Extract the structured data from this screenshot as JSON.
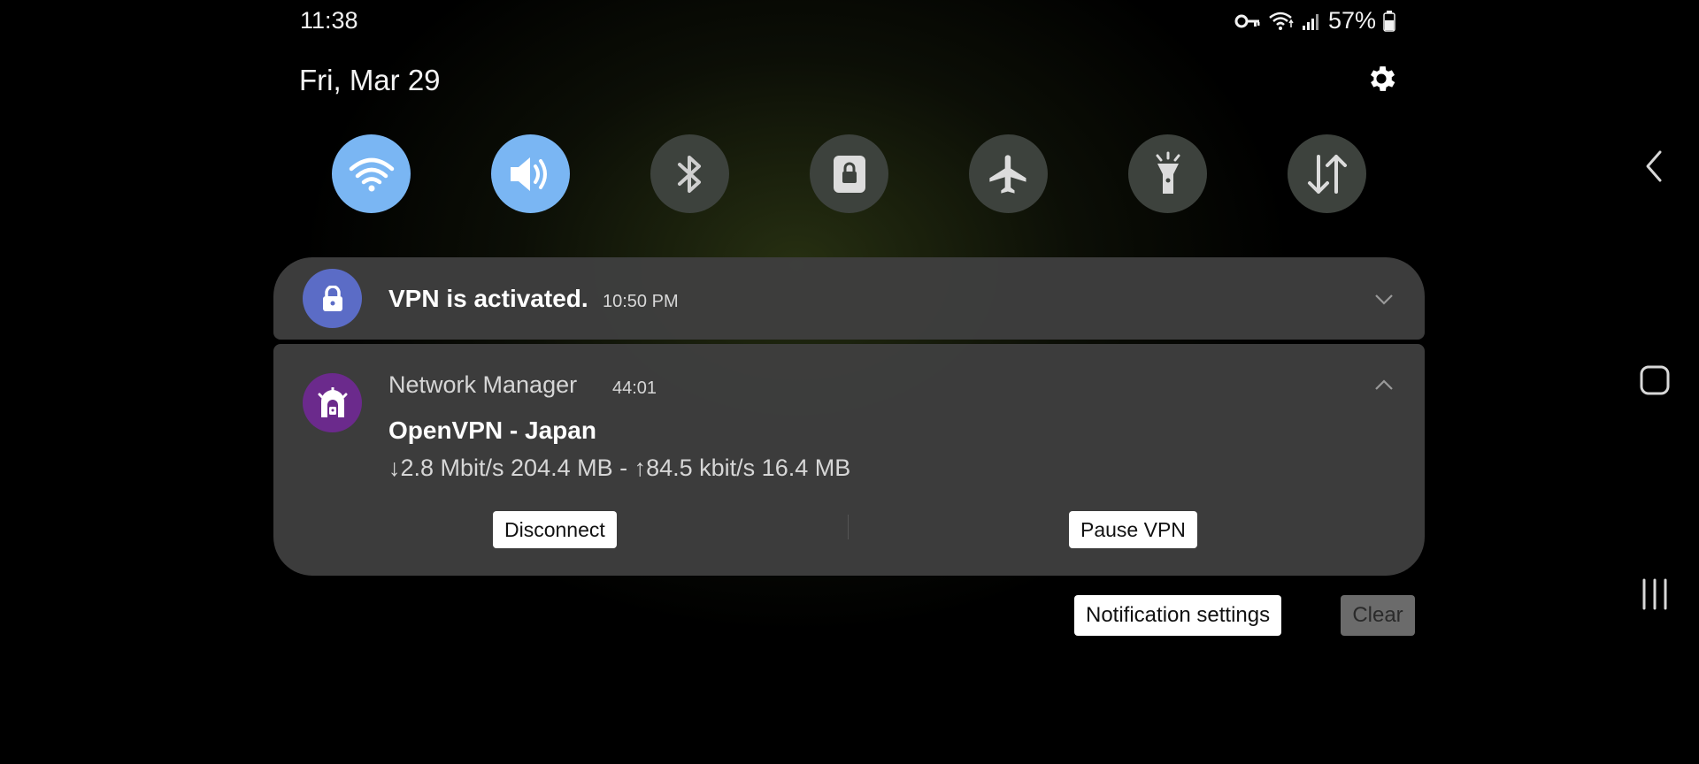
{
  "status_bar": {
    "time": "11:38",
    "battery": "57%",
    "icons": [
      "vpn-key-icon",
      "wifi-icon",
      "signal-icon",
      "battery-icon"
    ]
  },
  "header": {
    "date": "Fri, Mar 29",
    "settings_icon": "gear-icon"
  },
  "quick_settings": [
    {
      "name": "wifi",
      "icon": "wifi-icon",
      "state": "on"
    },
    {
      "name": "sound",
      "icon": "sound-icon",
      "state": "on"
    },
    {
      "name": "bluetooth",
      "icon": "bluetooth-icon",
      "state": "off"
    },
    {
      "name": "rotation-lock",
      "icon": "portrait-lock-icon",
      "state": "off"
    },
    {
      "name": "airplane-mode",
      "icon": "airplane-icon",
      "state": "off"
    },
    {
      "name": "flashlight",
      "icon": "flashlight-icon",
      "state": "off"
    },
    {
      "name": "mobile-data",
      "icon": "data-arrows-icon",
      "state": "off"
    }
  ],
  "notifications": {
    "vpn": {
      "title": "VPN is activated.",
      "time": "10:50 PM",
      "icon": "lock-icon",
      "icon_color": "#5b6cc6"
    },
    "network_manager": {
      "app_name": "Network Manager",
      "time": "44:01",
      "icon_color": "#6b2a8c",
      "title": "OpenVPN - Japan",
      "text": "↓2.8 Mbit/s 204.4 MB - ↑84.5 kbit/s 16.4 MB",
      "actions": {
        "disconnect": "Disconnect",
        "pause": "Pause VPN"
      }
    }
  },
  "footer": {
    "notification_settings": "Notification settings",
    "clear": "Clear"
  },
  "nav_bar": [
    "back-icon",
    "home-icon",
    "recents-icon"
  ],
  "colors": {
    "qs_on": "#7ab6f3",
    "qs_off": "#3d423d",
    "card": "#3e3e3e"
  }
}
